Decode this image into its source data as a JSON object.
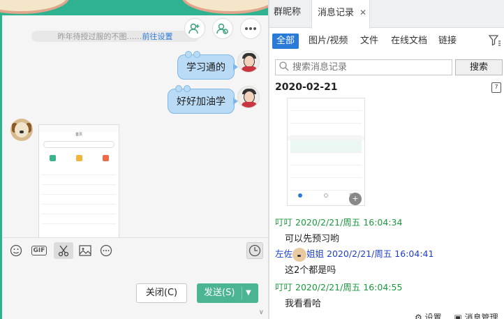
{
  "top": {
    "title_fragment": ""
  },
  "chat": {
    "system_msg": "昨年待授过服的不图……",
    "system_link": "前往设置",
    "messages": [
      {
        "text": "学习通的"
      },
      {
        "text": "好好加油学"
      }
    ],
    "phone_title": "首页"
  },
  "toolbar": {
    "gif_label": "GIF"
  },
  "buttons": {
    "close": "关闭(C)",
    "send": "发送(S)"
  },
  "right": {
    "tabs": [
      {
        "label": "群昵称"
      },
      {
        "label": "消息记录"
      }
    ],
    "filters": [
      {
        "label": "全部"
      },
      {
        "label": "图片/视频"
      },
      {
        "label": "文件"
      },
      {
        "label": "在线文档"
      },
      {
        "label": "链接"
      }
    ],
    "search_placeholder": "搜索消息记录",
    "search_button": "搜索",
    "date": "2020-02-21",
    "calendar_digit": "7",
    "records": [
      {
        "sender": "叮叮",
        "time": "2020/2/21/周五 16:04:34",
        "text": "可以先预习哟"
      },
      {
        "sender": "左佐",
        "sender_suffix": "姐姐",
        "time": "2020/2/21/周五 16:04:41",
        "text": "这2个都是吗"
      },
      {
        "sender": "叮叮",
        "time": "2020/2/21/周五 16:04:55",
        "text": "我看看哈"
      }
    ],
    "bottom": [
      "设置",
      "消息管理"
    ]
  }
}
